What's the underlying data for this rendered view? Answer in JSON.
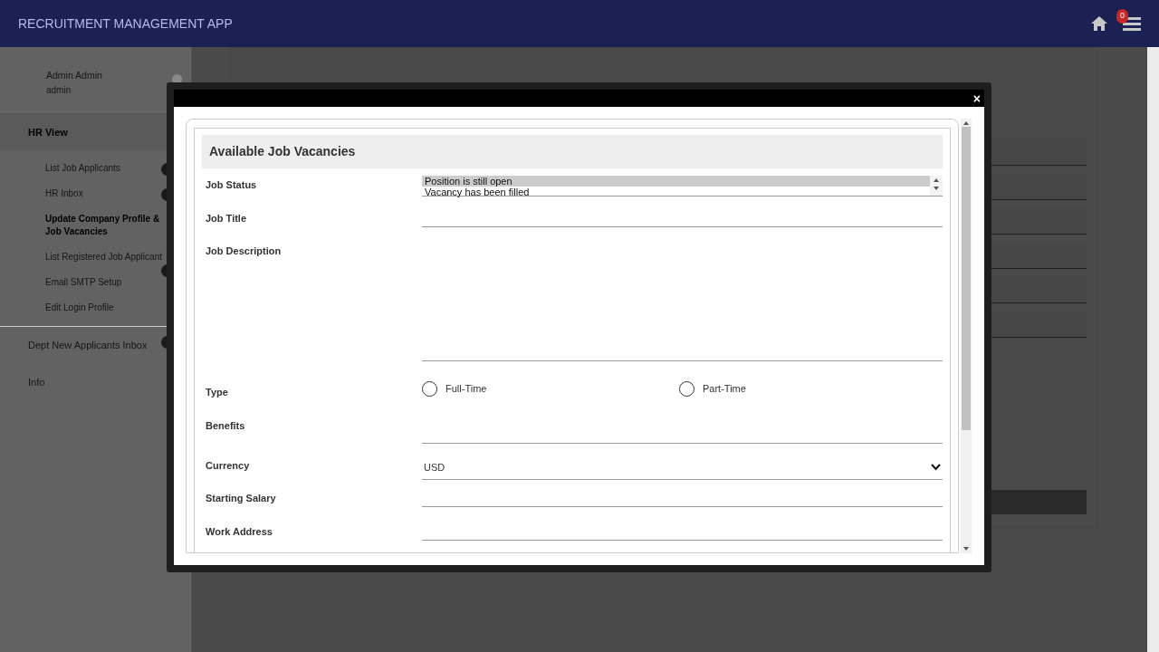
{
  "header": {
    "title": "RECRUITMENT MANAGEMENT APP",
    "notification_count": "0"
  },
  "sidebar": {
    "user": {
      "name": "Admin Admin",
      "username": "admin"
    },
    "sections": [
      {
        "label": "HR View",
        "items": [
          {
            "label": "List Job Applicants",
            "selected": false,
            "badge": true
          },
          {
            "label": "HR Inbox",
            "selected": false,
            "badge": true
          },
          {
            "label": "Update Company Profile & Job Vacancies",
            "selected": true,
            "badge": false
          },
          {
            "label": "List Registered Job Applicant",
            "selected": false,
            "badge": true
          },
          {
            "label": "Email SMTP Setup",
            "selected": false,
            "badge": false
          },
          {
            "label": "Edit Login Profile",
            "selected": false,
            "badge": false
          }
        ]
      },
      {
        "label": "Dept New Applicants Inbox",
        "badge": true
      },
      {
        "label": "Info",
        "badge": false
      }
    ]
  },
  "modal": {
    "close_button": "×",
    "title": "Available Job Vacancies",
    "fields": [
      {
        "kind": "listbox",
        "label": "Job Status",
        "options": [
          {
            "label": "Position is still open",
            "selected": true
          },
          {
            "label": "Vacancy has been filled",
            "selected": false
          }
        ]
      },
      {
        "kind": "text",
        "label": "Job Title"
      },
      {
        "kind": "textarea",
        "label": "Job Description"
      },
      {
        "kind": "radio",
        "label": "Type",
        "options": [
          {
            "label": "Full-Time",
            "selected": false
          },
          {
            "label": "Part-Time",
            "selected": false
          }
        ]
      },
      {
        "kind": "short-area",
        "label": "Benefits"
      },
      {
        "kind": "select",
        "label": "Currency",
        "value": "USD"
      },
      {
        "kind": "text",
        "label": "Starting Salary"
      },
      {
        "kind": "text",
        "label": "Work Address"
      }
    ]
  }
}
